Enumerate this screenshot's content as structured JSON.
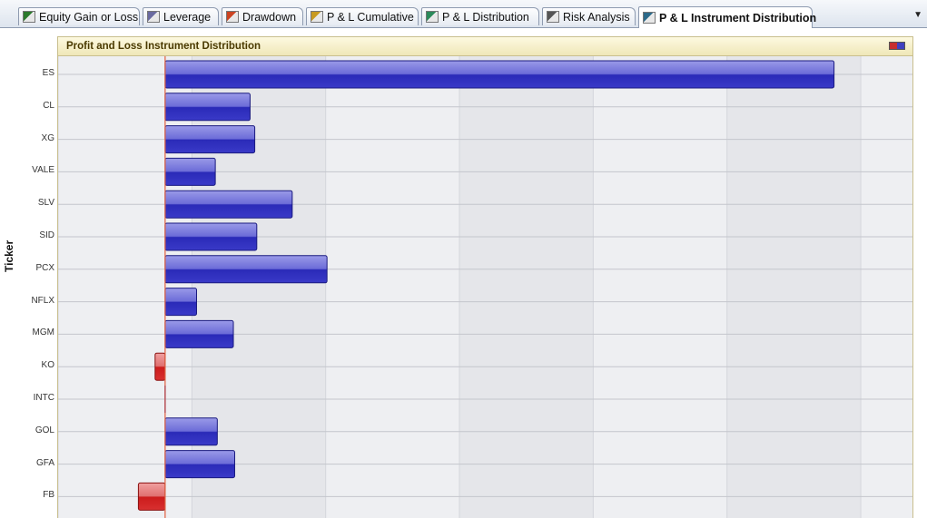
{
  "tabs": [
    {
      "label": "Equity Gain or Loss",
      "icon": "bar-chart-icon",
      "active": false
    },
    {
      "label": "Leverage",
      "icon": "percent-icon",
      "active": false
    },
    {
      "label": "Drawdown",
      "icon": "drawdown-icon",
      "active": false
    },
    {
      "label": "P & L Cumulative",
      "icon": "money-bag-icon",
      "active": false
    },
    {
      "label": "P & L Distribution",
      "icon": "distribution-chart-icon",
      "active": false
    },
    {
      "label": "Risk Analysis",
      "icon": "risk-formula-icon",
      "active": false
    },
    {
      "label": "P & L Instrument Distribution",
      "icon": "instrument-chart-icon",
      "active": true
    }
  ],
  "tab_menu_glyph": "▼",
  "colors": {
    "positive": "#3838c0",
    "negative": "#cc2a2a",
    "zero_line": "#e06040",
    "panel_header": "#efe7b8"
  },
  "chart_data": {
    "type": "bar",
    "orientation": "horizontal",
    "title": "Profit and Loss Instrument Distribution",
    "ylabel": "Ticker",
    "xlabel": "",
    "categories": [
      "ES",
      "CL",
      "XG",
      "VALE",
      "SLV",
      "SID",
      "PCX",
      "NFLX",
      "MGM",
      "KO",
      "INTC",
      "GOL",
      "GFA",
      "FB"
    ],
    "values": [
      100,
      12.7,
      13.4,
      7.5,
      19,
      13.7,
      24.2,
      4.7,
      10.2,
      -1.5,
      0,
      7.8,
      10.4,
      -4
    ],
    "xlim": [
      -16,
      112
    ],
    "grid": true,
    "legend_placement": "top-right"
  }
}
